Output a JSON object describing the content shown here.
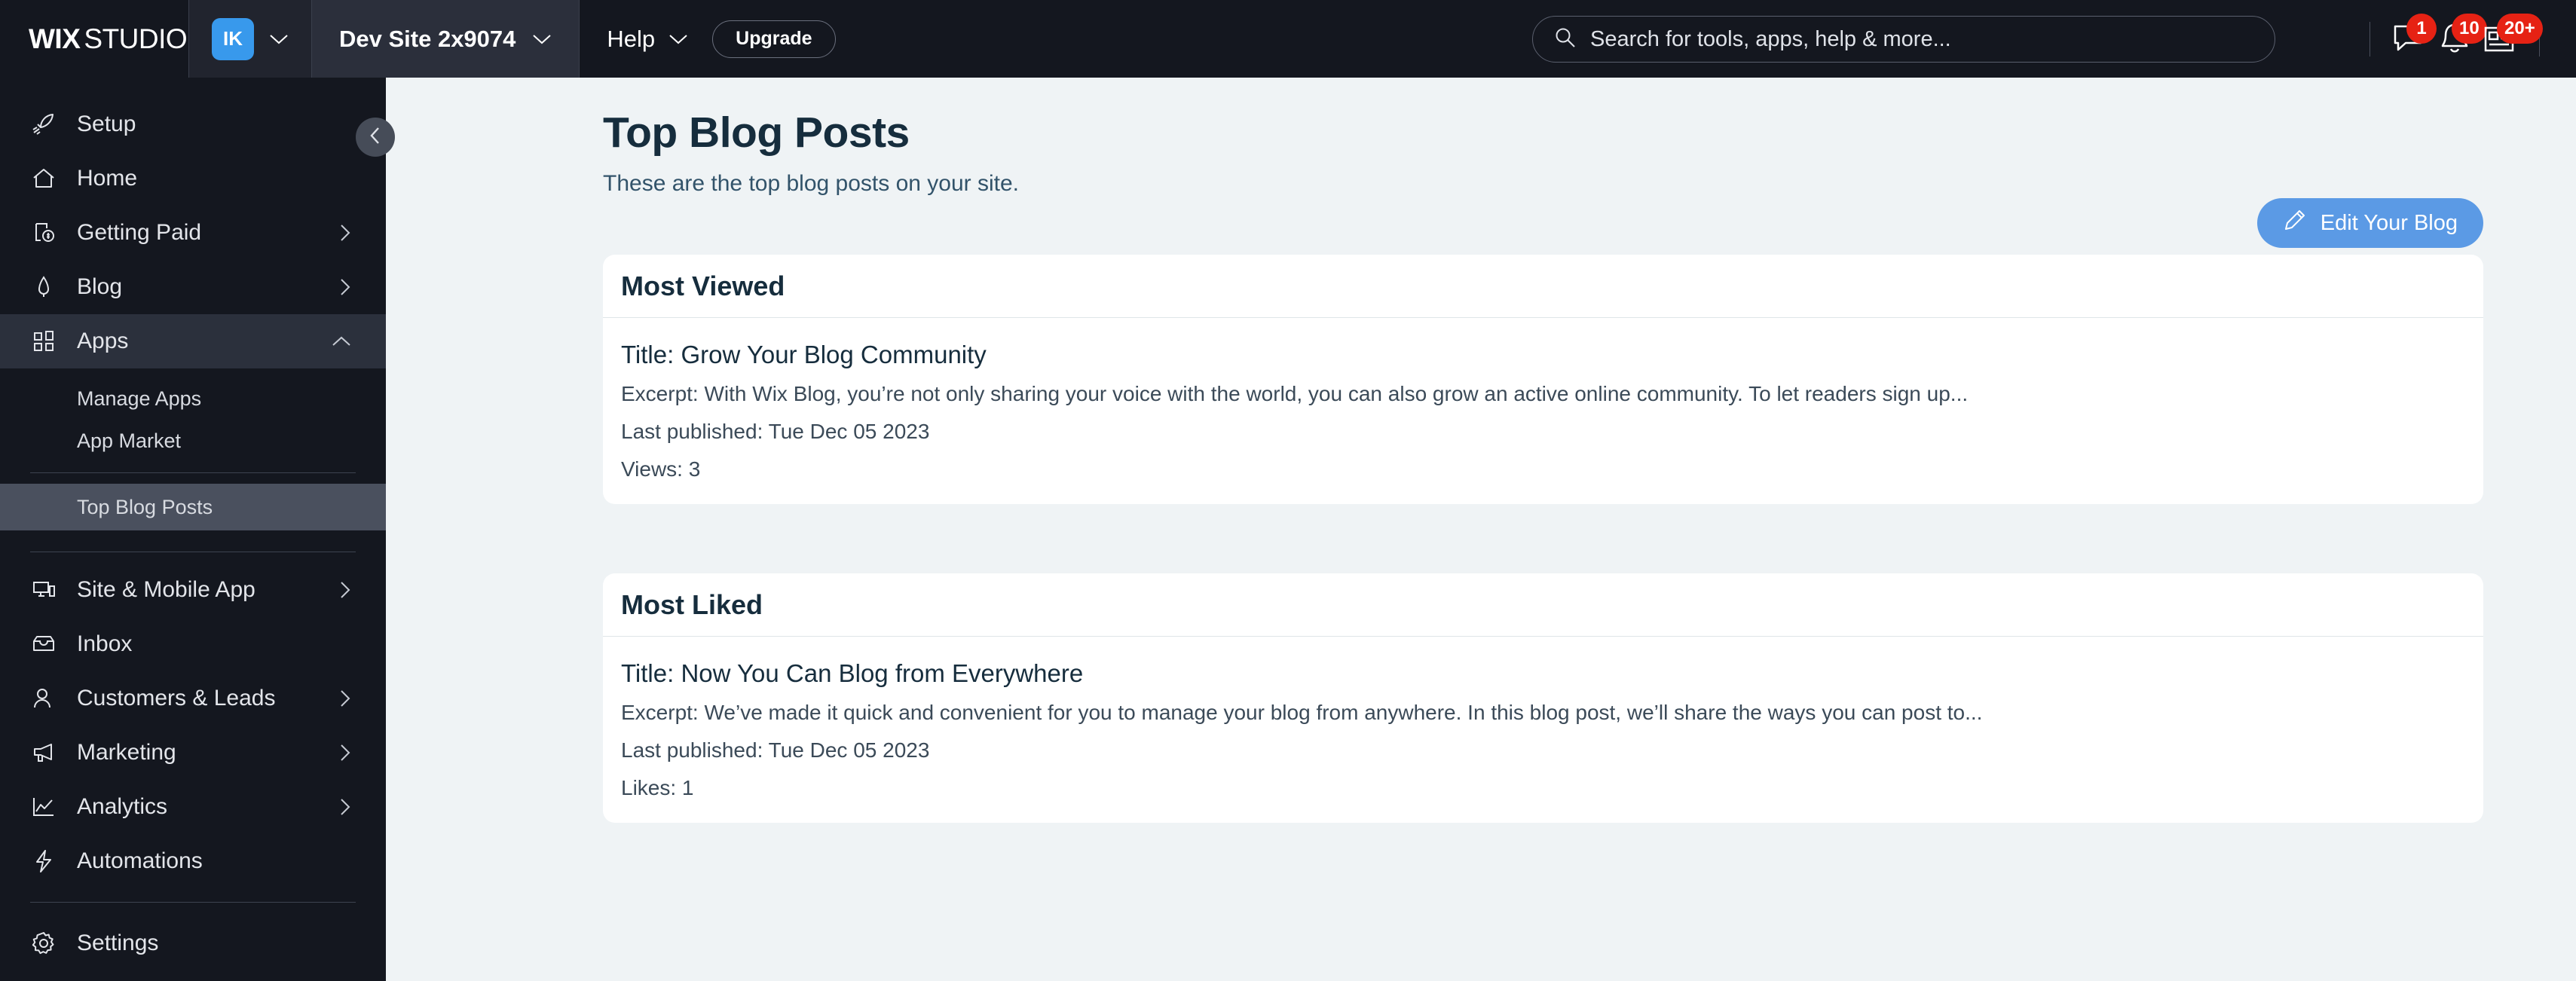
{
  "topbar": {
    "logo_bold": "WIX",
    "logo_light": "STUDIO",
    "avatar_initials": "IK",
    "site_name": "Dev Site 2x9074",
    "help_label": "Help",
    "upgrade_label": "Upgrade",
    "search_placeholder": "Search for tools, apps, help & more...",
    "badges": {
      "chat": "1",
      "notifications": "10",
      "news": "20+"
    }
  },
  "sidebar": {
    "items": [
      {
        "label": "Setup",
        "icon": "rocket-icon",
        "arrow": ""
      },
      {
        "label": "Home",
        "icon": "home-icon",
        "arrow": ""
      },
      {
        "label": "Getting Paid",
        "icon": "invoice-dollar-icon",
        "arrow": "right"
      },
      {
        "label": "Blog",
        "icon": "pen-icon",
        "arrow": "right"
      },
      {
        "label": "Apps",
        "icon": "apps-grid-icon",
        "arrow": "up"
      }
    ],
    "apps_subitems": [
      {
        "label": "Manage Apps"
      },
      {
        "label": "App Market"
      }
    ],
    "app_page": {
      "label": "Top Blog Posts"
    },
    "items_lower": [
      {
        "label": "Site & Mobile App",
        "icon": "devices-icon",
        "arrow": "right"
      },
      {
        "label": "Inbox",
        "icon": "inbox-icon",
        "arrow": ""
      },
      {
        "label": "Customers & Leads",
        "icon": "people-icon",
        "arrow": "right"
      },
      {
        "label": "Marketing",
        "icon": "megaphone-icon",
        "arrow": "right"
      },
      {
        "label": "Analytics",
        "icon": "chart-line-icon",
        "arrow": "right"
      },
      {
        "label": "Automations",
        "icon": "bolt-icon",
        "arrow": ""
      }
    ],
    "items_settings": [
      {
        "label": "Settings",
        "icon": "gear-icon",
        "arrow": ""
      }
    ]
  },
  "main": {
    "title": "Top Blog Posts",
    "subtitle": "These are the top blog posts on your site.",
    "edit_button": "Edit Your Blog",
    "cards": [
      {
        "heading": "Most Viewed",
        "title": "Title: Grow Your Blog Community",
        "excerpt": "Excerpt: With Wix Blog, you’re not only sharing your voice with the world, you can also grow an active online community. To let readers sign up...",
        "published": "Last published: Tue Dec 05 2023",
        "metric": "Views: 3"
      },
      {
        "heading": "Most Liked",
        "title": "Title: Now You Can Blog from Everywhere",
        "excerpt": "Excerpt: We’ve made it quick and convenient for you to manage your blog from anywhere. In this blog post, we’ll share the ways you can post to...",
        "published": "Last published: Tue Dec 05 2023",
        "metric": "Likes: 1"
      }
    ]
  },
  "colors": {
    "topbar_bg": "#14171f",
    "accent_blue": "#3899ec",
    "button_blue": "#5b9ae5",
    "badge_red": "#e62214",
    "page_bg": "#eff3f5",
    "heading": "#162d3d"
  }
}
